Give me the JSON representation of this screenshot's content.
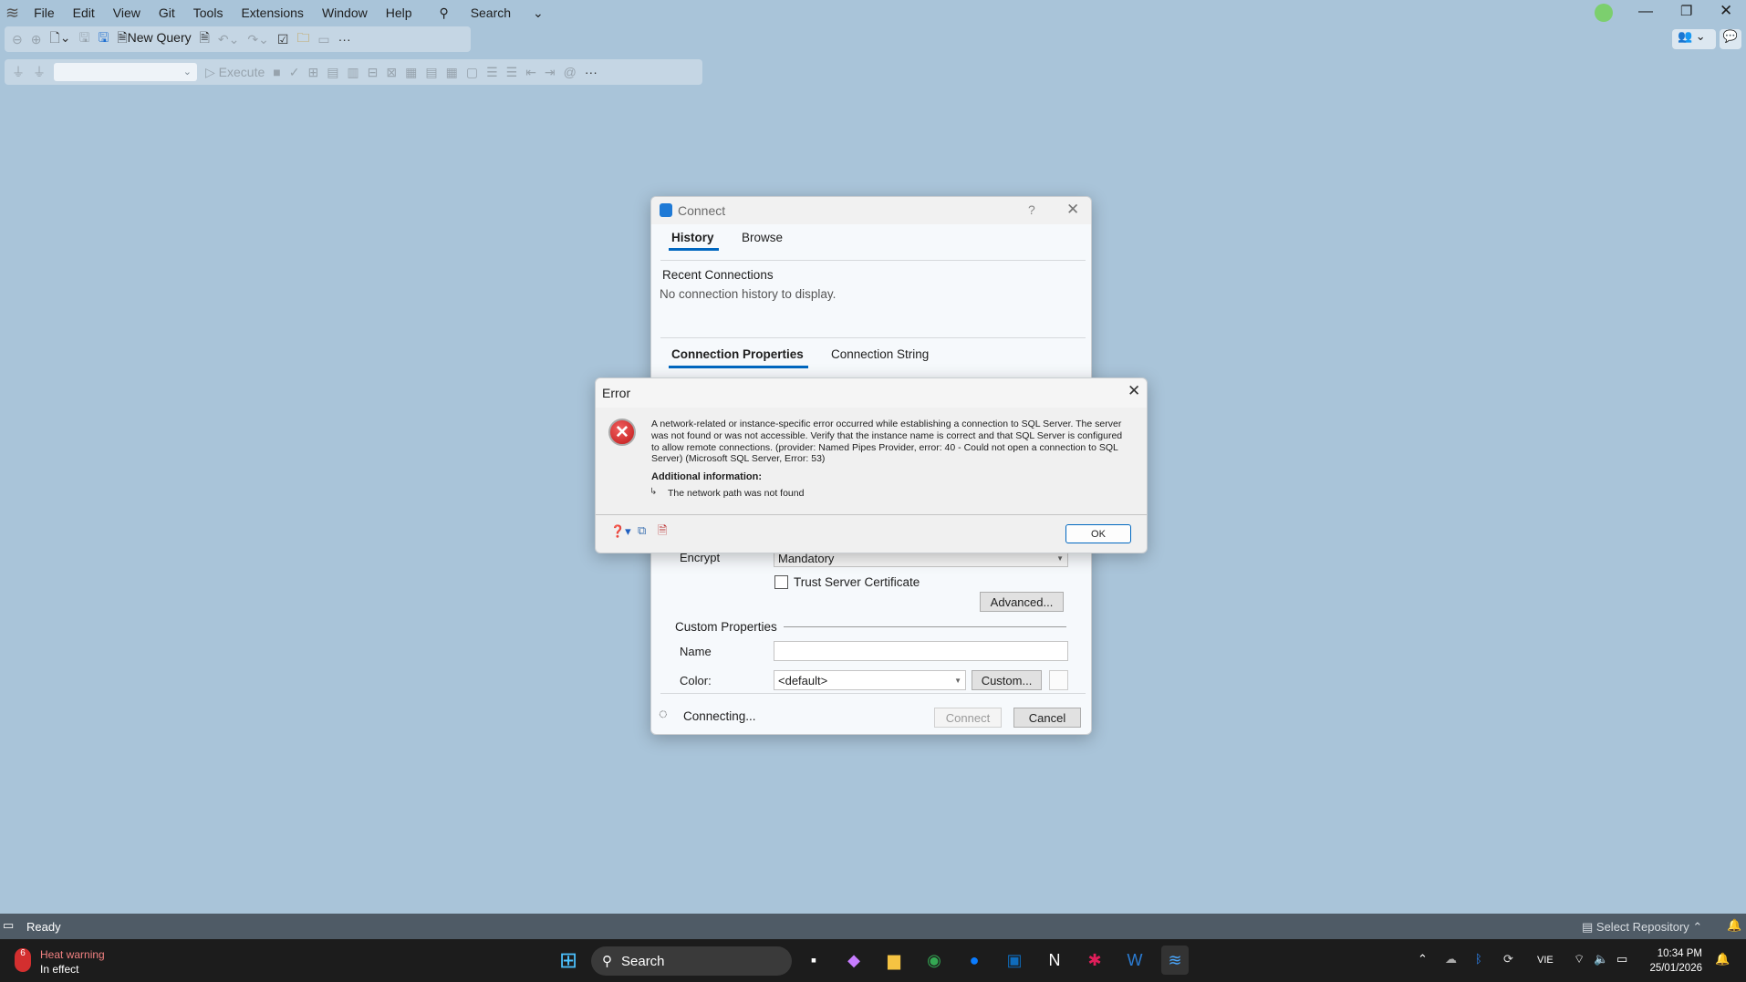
{
  "app": {
    "menu": [
      "File",
      "Edit",
      "View",
      "Git",
      "Tools",
      "Extensions",
      "Window",
      "Help"
    ],
    "search_label": "Search"
  },
  "toolbar1": {
    "new_query": "New Query",
    "more": "···"
  },
  "toolbar2": {
    "database_select": "",
    "execute": "Execute",
    "more": "···"
  },
  "connect_dialog": {
    "title": "Connect",
    "help": "?",
    "tabs": [
      "History",
      "Browse"
    ],
    "recent_title": "Recent Connections",
    "recent_empty": "No connection history to display.",
    "prop_tabs": [
      "Connection Properties",
      "Connection String"
    ],
    "encrypt_label": "Encrypt",
    "encrypt_value": "Mandatory",
    "trust_label": "Trust Server Certificate",
    "trust_checked": false,
    "advanced": "Advanced...",
    "custom_props": "Custom Properties",
    "name_label": "Name",
    "name_value": "",
    "color_label": "Color:",
    "color_value": "<default>",
    "custom_btn": "Custom...",
    "status": "Connecting...",
    "connect_btn": "Connect",
    "cancel_btn": "Cancel"
  },
  "error_dialog": {
    "title": "Error",
    "message": "A network-related or instance-specific error occurred while establishing a connection to SQL Server. The server was not found or was not accessible. Verify that the instance name is correct and that SQL Server is configured to allow remote connections. (provider: Named Pipes Provider, error: 40 - Could not open a connection to SQL Server) (Microsoft SQL Server, Error: 53)",
    "additional_title": "Additional information:",
    "additional_detail": "The network path was not found",
    "ok": "OK"
  },
  "statusbar": {
    "status": "Ready",
    "repo": "Select Repository"
  },
  "taskbar": {
    "weather_title": "Heat warning",
    "weather_sub": "In effect",
    "search": "Search",
    "lang": "VIE",
    "time": "10:34 PM",
    "date": "25/01/2026",
    "weather_badge": "6"
  },
  "colors": {
    "accent": "#0067c0",
    "background": "#a9c4d9",
    "statusbar": "#4f5b66",
    "taskbar": "#1c1c1c",
    "error_red": "#d32f2f"
  }
}
